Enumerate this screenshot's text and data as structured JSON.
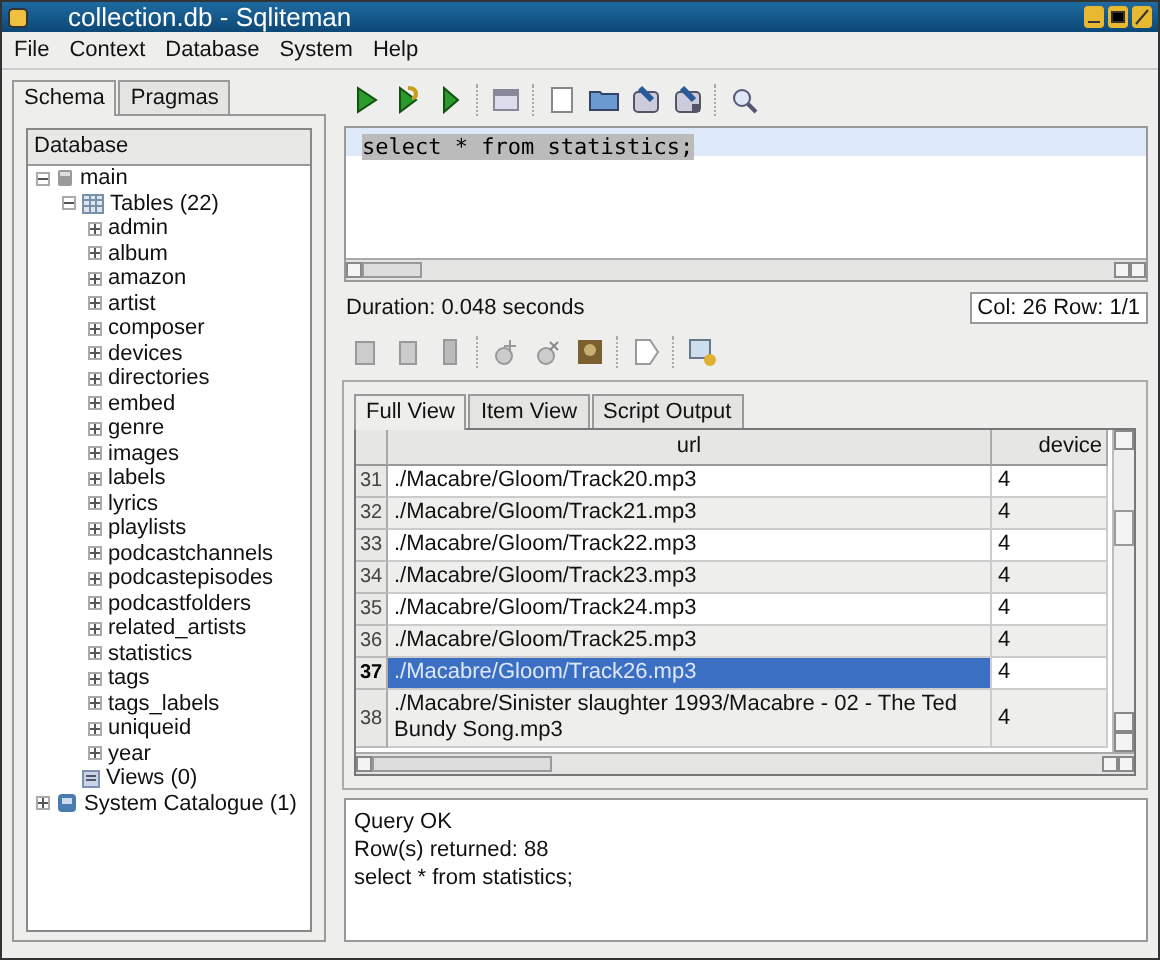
{
  "window": {
    "title": "collection.db - Sqliteman"
  },
  "menu": [
    "File",
    "Context",
    "Database",
    "System",
    "Help"
  ],
  "left_tabs": [
    {
      "label": "Schema",
      "selected": true
    },
    {
      "label": "Pragmas",
      "selected": false
    }
  ],
  "tree": {
    "header": "Database",
    "items": [
      {
        "label": "main",
        "kind": "db",
        "expanded": true,
        "children": [
          {
            "label": "Tables (22)",
            "kind": "tables",
            "expanded": true,
            "children": [
              {
                "label": "admin",
                "expanded": false
              },
              {
                "label": "album",
                "expanded": false
              },
              {
                "label": "amazon",
                "expanded": false
              },
              {
                "label": "artist",
                "expanded": false
              },
              {
                "label": "composer",
                "expanded": false
              },
              {
                "label": "devices",
                "expanded": false
              },
              {
                "label": "directories",
                "expanded": false
              },
              {
                "label": "embed",
                "expanded": false
              },
              {
                "label": "genre",
                "expanded": false
              },
              {
                "label": "images",
                "expanded": false
              },
              {
                "label": "labels",
                "expanded": false
              },
              {
                "label": "lyrics",
                "expanded": false
              },
              {
                "label": "playlists",
                "expanded": false
              },
              {
                "label": "podcastchannels",
                "expanded": false
              },
              {
                "label": "podcastepisodes",
                "expanded": false
              },
              {
                "label": "podcastfolders",
                "expanded": false
              },
              {
                "label": "related_artists",
                "expanded": false
              },
              {
                "label": "statistics",
                "expanded": false
              },
              {
                "label": "tags",
                "expanded": false
              },
              {
                "label": "tags_labels",
                "expanded": false
              },
              {
                "label": "uniqueid",
                "expanded": false
              },
              {
                "label": "year",
                "expanded": false
              }
            ]
          },
          {
            "label": "Views (0)",
            "kind": "views"
          }
        ]
      },
      {
        "label": "System Catalogue (1)",
        "kind": "catalogue",
        "expanded": false
      }
    ]
  },
  "editor": {
    "sql": "select * from statistics;"
  },
  "duration": "Duration: 0.048 seconds",
  "cursor_position": "Col: 26 Row: 1/1",
  "result_tabs": [
    {
      "label": "Full View",
      "selected": true
    },
    {
      "label": "Item View",
      "selected": false
    },
    {
      "label": "Script Output",
      "selected": false
    }
  ],
  "table": {
    "columns": [
      "url",
      "device"
    ],
    "rows": [
      {
        "number": "31",
        "cells": [
          "./Macabre/Gloom/Track20.mp3",
          "4"
        ],
        "selected": false
      },
      {
        "number": "32",
        "cells": [
          "./Macabre/Gloom/Track21.mp3",
          "4"
        ],
        "selected": false
      },
      {
        "number": "33",
        "cells": [
          "./Macabre/Gloom/Track22.mp3",
          "4"
        ],
        "selected": false
      },
      {
        "number": "34",
        "cells": [
          "./Macabre/Gloom/Track23.mp3",
          "4"
        ],
        "selected": false
      },
      {
        "number": "35",
        "cells": [
          "./Macabre/Gloom/Track24.mp3",
          "4"
        ],
        "selected": false
      },
      {
        "number": "36",
        "cells": [
          "./Macabre/Gloom/Track25.mp3",
          "4"
        ],
        "selected": false
      },
      {
        "number": "37",
        "cells": [
          "./Macabre/Gloom/Track26.mp3",
          "4"
        ],
        "selected": true
      },
      {
        "number": "38",
        "cells": [
          "./Macabre/Sinister slaughter 1993/Macabre - 02 - The Ted Bundy Song.mp3",
          "4"
        ],
        "selected": false
      }
    ]
  },
  "output": [
    "Query OK",
    "Row(s) returned: 88",
    "select * from statistics;"
  ]
}
